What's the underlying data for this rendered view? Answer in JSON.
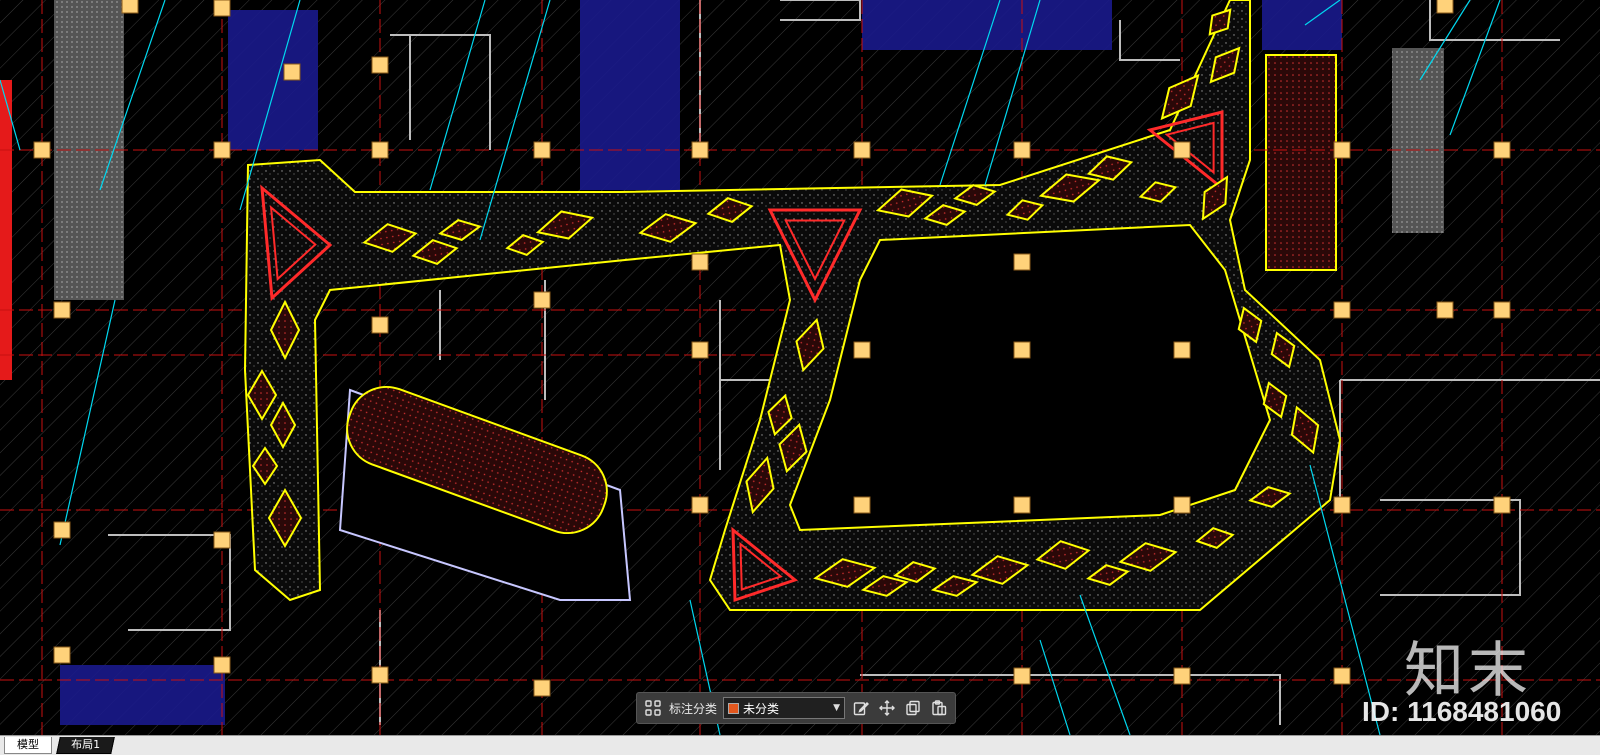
{
  "toolbar": {
    "category_label": "标注分类",
    "selected_category": "未分类",
    "selected_color": "#e2571e",
    "icons": [
      "grid-icon",
      "edit-icon",
      "move-icon",
      "copy-icon",
      "paste-icon"
    ]
  },
  "watermark": {
    "logo_text": "知末",
    "id_text": "ID: 1168481060"
  },
  "tabs": {
    "model": "模型",
    "layout1": "布局1"
  },
  "colors": {
    "background": "#000000",
    "walkway_outline": "#ffff00",
    "planter_outline": "#ff2a2a",
    "grid_line": "#d01010",
    "leader_line": "#00e5ff",
    "hatch_blue": "#1a1a8c",
    "column": "#ffd27a"
  }
}
